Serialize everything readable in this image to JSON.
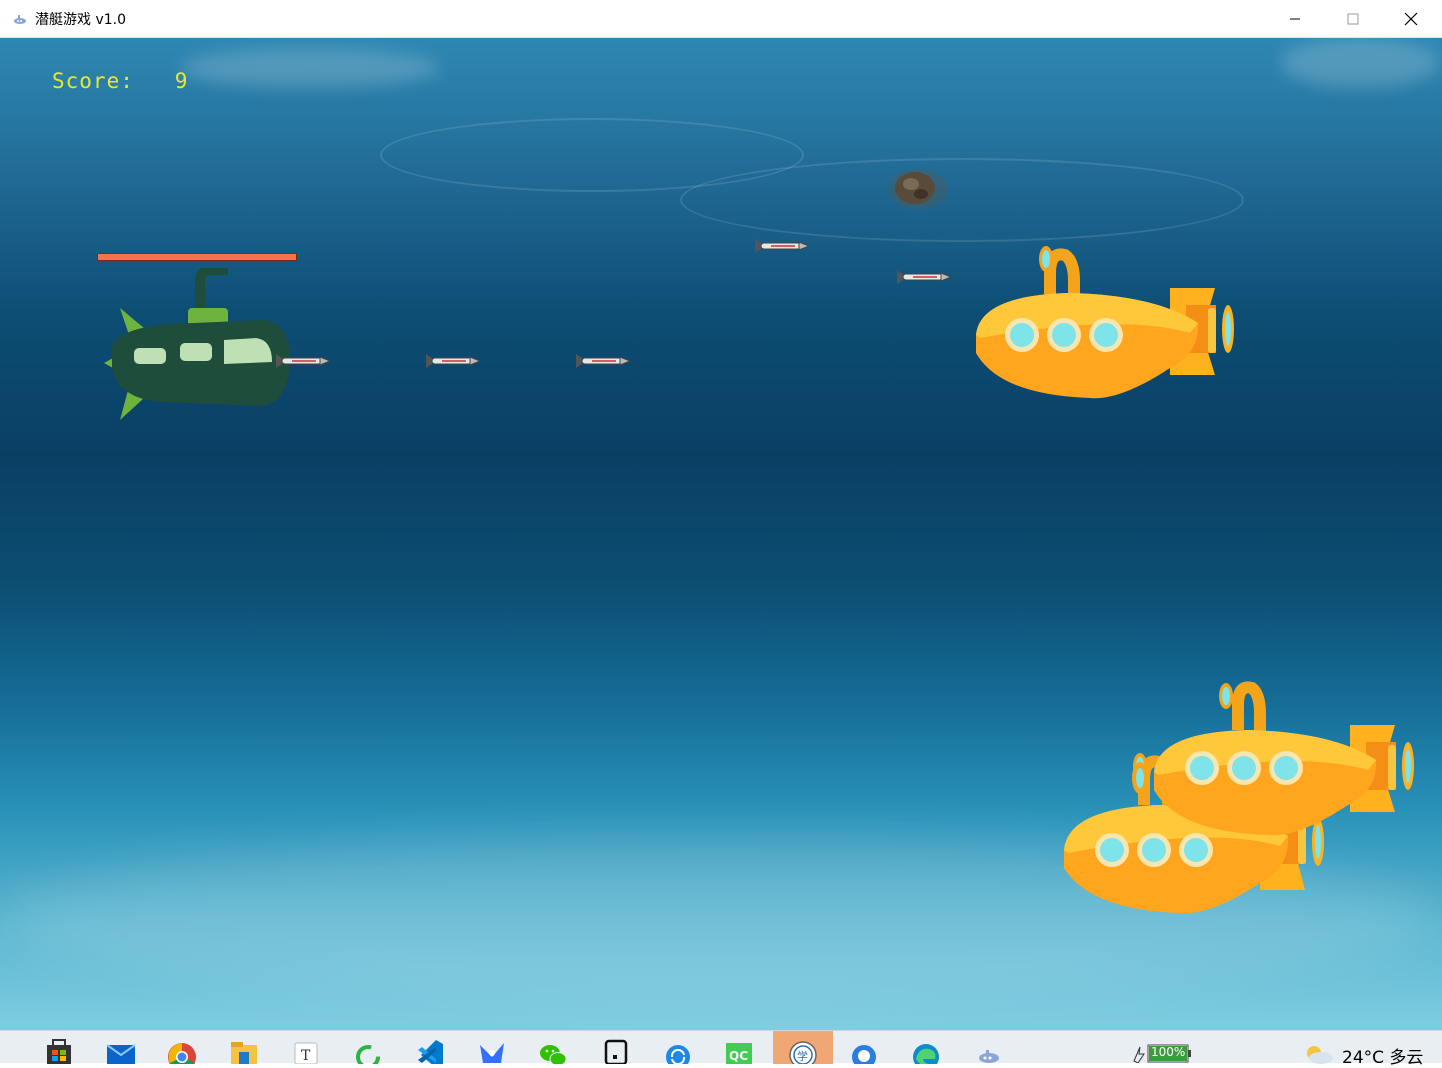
{
  "window": {
    "title": "潜艇游戏 v1.0",
    "controls": [
      "minimize",
      "maximize",
      "close"
    ]
  },
  "hud": {
    "score_label": "Score:",
    "score_value": "9",
    "player_health_fraction": 1.0
  },
  "scene": {
    "player_submarine": {
      "color": "#1f4d3b",
      "accent": "#6fb33f",
      "window_color": "#bfe0b4"
    },
    "enemy_submarine_color": "#ffa51e",
    "enemy_submarine_count": 3,
    "torpedo_count": 5,
    "explosion_count": 1
  },
  "taskbar": {
    "apps": [
      "store-icon",
      "mail-icon",
      "chrome-icon",
      "file-explorer-icon",
      "typora-icon",
      "sync-icon",
      "vscode-icon",
      "feishu-icon",
      "wechat-icon",
      "tablet-icon",
      "sync-blue-icon",
      "qc-icon",
      "school-icon",
      "search-app-icon",
      "edge-icon",
      "submarine-game-icon"
    ],
    "battery": "100%",
    "weather": "24°C  多云"
  },
  "colors": {
    "score_text": "#e8ea2a",
    "health_bar": "#f2744a",
    "taskbar_active": "#f1a774"
  }
}
